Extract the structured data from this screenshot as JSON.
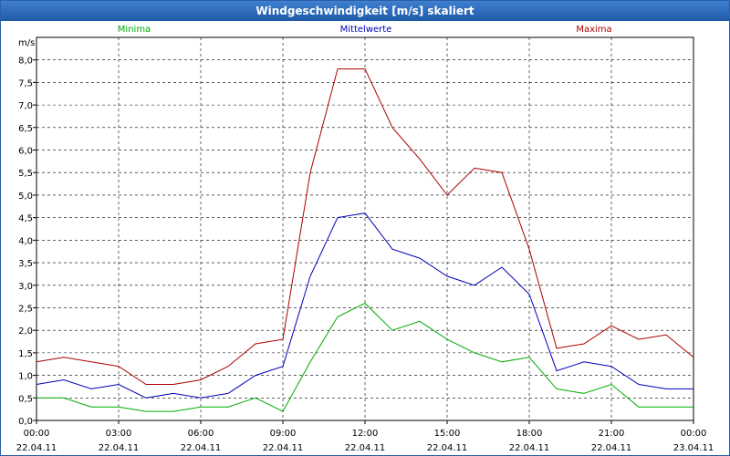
{
  "window": {
    "title": "Windgeschwindigkeit [m/s] skaliert"
  },
  "chart_data": {
    "type": "line",
    "y_unit": "m/s",
    "ylim": [
      0,
      8.5
    ],
    "y_ticks": [
      "0,0",
      "0,5",
      "1,0",
      "1,5",
      "2,0",
      "2,5",
      "3,0",
      "3,5",
      "4,0",
      "4,5",
      "5,0",
      "5,5",
      "6,0",
      "6,5",
      "7,0",
      "7,5",
      "8,0"
    ],
    "y_tick_values": [
      0,
      0.5,
      1,
      1.5,
      2,
      2.5,
      3,
      3.5,
      4,
      4.5,
      5,
      5.5,
      6,
      6.5,
      7,
      7.5,
      8
    ],
    "x_range_hours": [
      0,
      24
    ],
    "x_ticks": [
      {
        "hour": 0,
        "time": "00:00",
        "date": "22.04.11"
      },
      {
        "hour": 3,
        "time": "03:00",
        "date": "22.04.11"
      },
      {
        "hour": 6,
        "time": "06:00",
        "date": "22.04.11"
      },
      {
        "hour": 9,
        "time": "09:00",
        "date": "22.04.11"
      },
      {
        "hour": 12,
        "time": "12:00",
        "date": "22.04.11"
      },
      {
        "hour": 15,
        "time": "15:00",
        "date": "22.04.11"
      },
      {
        "hour": 18,
        "time": "18:00",
        "date": "22.04.11"
      },
      {
        "hour": 21,
        "time": "21:00",
        "date": "22.04.11"
      },
      {
        "hour": 24,
        "time": "00:00",
        "date": "23.04.11"
      }
    ],
    "grid": true,
    "legend": [
      "Minima",
      "Mittelwerte",
      "Maxima"
    ],
    "x_hours": [
      0,
      1,
      2,
      3,
      4,
      5,
      6,
      7,
      8,
      9,
      10,
      11,
      12,
      13,
      14,
      15,
      16,
      17,
      18,
      19,
      20,
      21,
      22,
      23,
      24
    ],
    "series": [
      {
        "name": "Minima",
        "color": "#00aa00",
        "values": [
          0.5,
          0.5,
          0.3,
          0.3,
          0.2,
          0.2,
          0.3,
          0.3,
          0.5,
          0.2,
          1.3,
          2.3,
          2.6,
          2.0,
          2.2,
          1.8,
          1.5,
          1.3,
          1.4,
          0.7,
          0.6,
          0.8,
          0.3,
          0.3,
          0.3
        ]
      },
      {
        "name": "Mittelwerte",
        "color": "#0000bb",
        "values": [
          0.8,
          0.9,
          0.7,
          0.8,
          0.5,
          0.6,
          0.5,
          0.6,
          1.0,
          1.2,
          3.2,
          4.5,
          4.6,
          3.8,
          3.6,
          3.2,
          3.0,
          3.4,
          2.8,
          1.1,
          1.3,
          1.2,
          0.8,
          0.7,
          0.7
        ]
      },
      {
        "name": "Maxima",
        "color": "#aa0000",
        "values": [
          1.3,
          1.4,
          1.3,
          1.2,
          0.8,
          0.8,
          0.9,
          1.2,
          1.7,
          1.8,
          5.5,
          7.8,
          7.8,
          6.5,
          5.8,
          5.0,
          5.6,
          5.5,
          3.8,
          1.6,
          1.7,
          2.1,
          1.8,
          1.9,
          1.4
        ]
      }
    ]
  }
}
